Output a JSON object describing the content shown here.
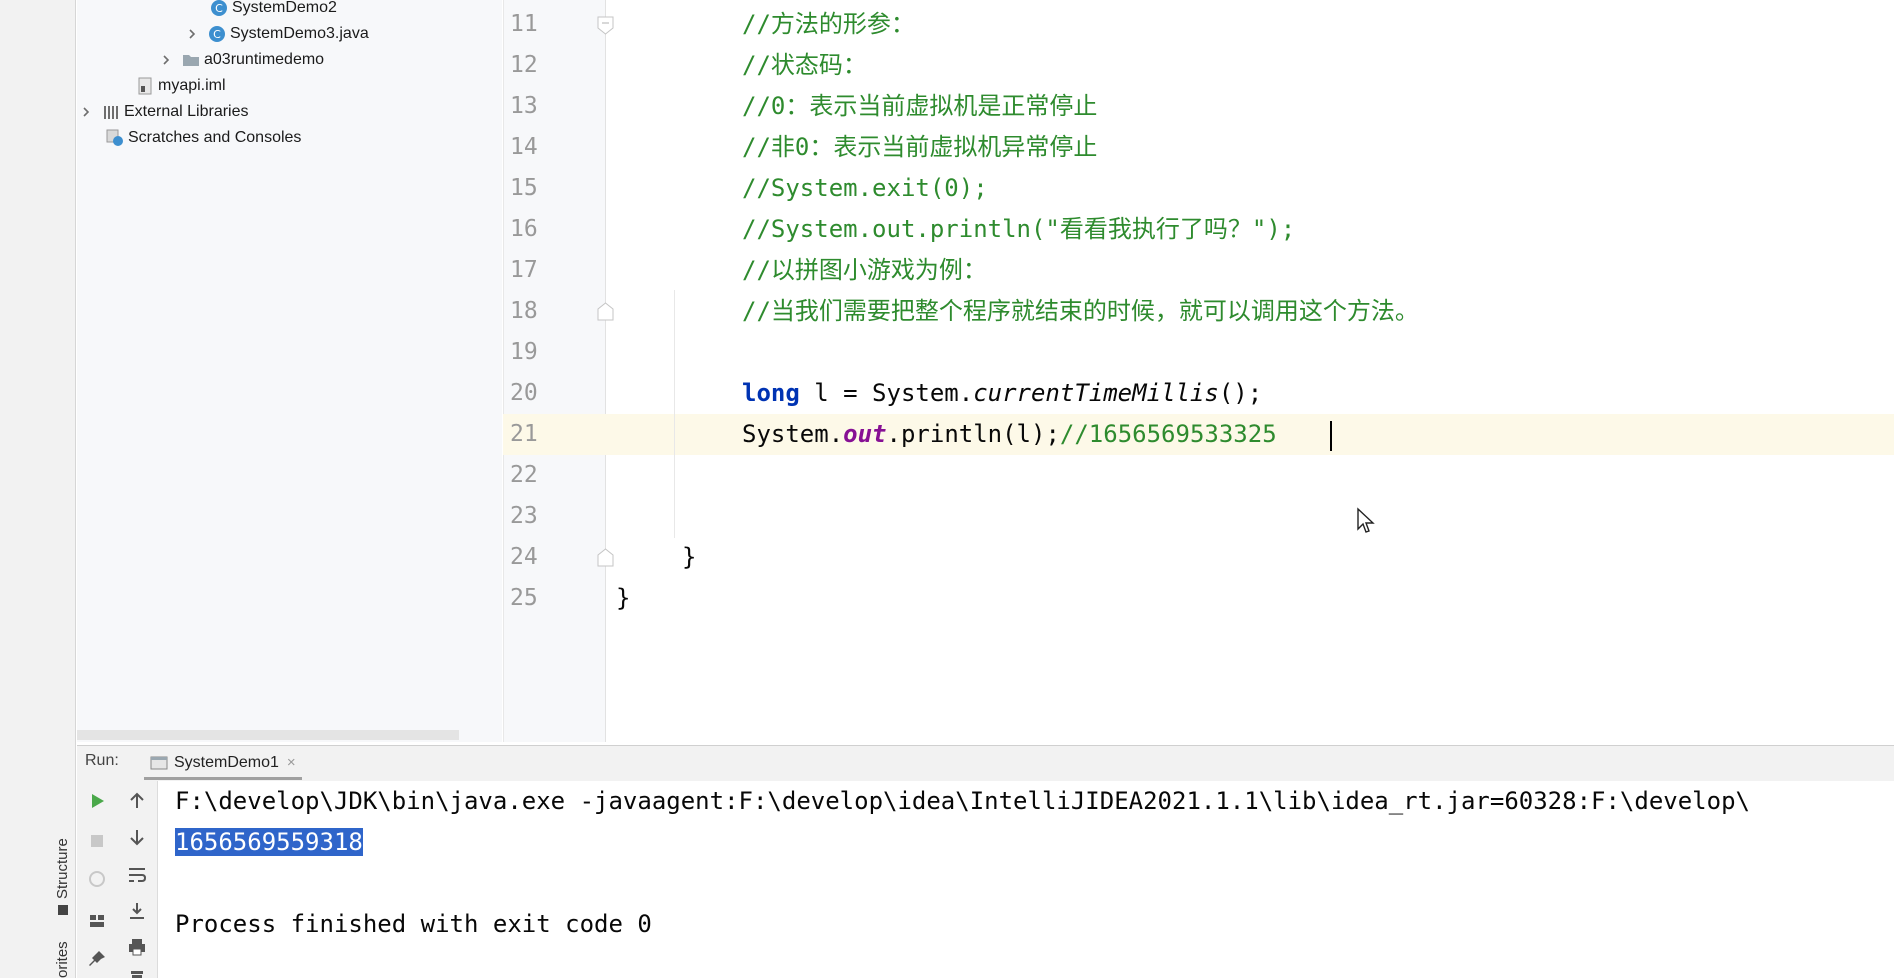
{
  "project_tree": [
    {
      "label": "SystemDemo2",
      "kind": "java-class",
      "expandable": false
    },
    {
      "label": "SystemDemo3.java",
      "kind": "java-class",
      "expandable": true
    },
    {
      "label": "a03runtimedemo",
      "kind": "folder",
      "expandable": true
    },
    {
      "label": "myapi.iml",
      "kind": "module-file",
      "expandable": false
    },
    {
      "label": "External Libraries",
      "kind": "library",
      "expandable": true
    },
    {
      "label": "Scratches and Consoles",
      "kind": "scratches",
      "expandable": false
    }
  ],
  "side_tabs": {
    "structure": "Structure",
    "favorites": "orites"
  },
  "editor": {
    "line_numbers": [
      "11",
      "12",
      "13",
      "14",
      "15",
      "16",
      "17",
      "18",
      "19",
      "20",
      "21",
      "22",
      "23",
      "24",
      "25"
    ],
    "lines": {
      "l11": "//方法的形参：",
      "l12": "//状态码：",
      "l13": "//0：表示当前虚拟机是正常停止",
      "l14": "//非0：表示当前虚拟机异常停止",
      "l15": "//System.exit(0);",
      "l16": "//System.out.println(\"看看我执行了吗？\");",
      "l17": "//以拼图小游戏为例：",
      "l18": "//当我们需要把整个程序就结束的时候，就可以调用这个方法。",
      "l20_kw": "long",
      "l20_mid": " l = System.",
      "l20_method": "currentTimeMillis",
      "l20_end": "();",
      "l21_a": "System.",
      "l21_field": "out",
      "l21_b": ".println(l);",
      "l21_comment": "//1656569533325",
      "l24": "}",
      "l25": "}"
    },
    "current_line": "21"
  },
  "run_panel": {
    "label": "Run:",
    "tab_title": "SystemDemo1",
    "tab_close": "×",
    "console": {
      "command": "F:\\develop\\JDK\\bin\\java.exe -javaagent:F:\\develop\\idea\\IntelliJIDEA2021.1.1\\lib\\idea_rt.jar=60328:F:\\develop\\",
      "output": "1656569559318",
      "finished": "Process finished with exit code 0"
    }
  },
  "colors": {
    "comment": "#2e8b2e",
    "keyword": "#0033b3",
    "static_field": "#871094",
    "selection": "#2f65ca",
    "current_line": "#fdf9e8"
  }
}
